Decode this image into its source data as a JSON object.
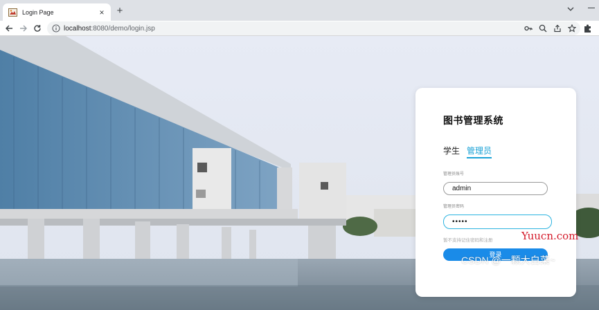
{
  "browser": {
    "tab_title": "Login Page",
    "tab_close": "×",
    "new_tab": "+",
    "url_host": "localhost",
    "url_rest": ":8080/demo/login.jsp"
  },
  "login": {
    "system_title": "图书管理系统",
    "tabs": [
      "学生",
      "管理员"
    ],
    "active_tab": "管理员",
    "account_label": "管理员账号",
    "account_value": "admin",
    "password_label": "管理员密码",
    "password_value": "•••••",
    "hint_text": "暂不支持记住密码和注册",
    "login_button": "登录"
  },
  "watermarks": {
    "yuucn": "Yuucn.com",
    "csdn": "CSDN @一颗大白菜~"
  },
  "colors": {
    "accent": "#1aa2d6",
    "button": "#1a8be8",
    "watermark_red": "#d41a2a"
  },
  "icons": {
    "back": "arrow-left-icon",
    "forward": "arrow-right-icon",
    "reload": "reload-icon",
    "info": "info-icon",
    "key": "key-icon",
    "zoom": "zoom-icon",
    "share": "share-icon",
    "bookmark": "star-icon",
    "extensions": "puzzle-icon"
  }
}
